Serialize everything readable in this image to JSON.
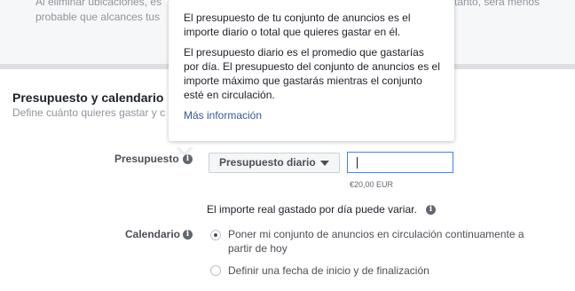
{
  "background_text": {
    "line1_left": "Al eliminar ubicaciones, es",
    "line1_right": "tanto, será menos",
    "line2": "probable que alcances tus"
  },
  "section": {
    "title": "Presupuesto y calendario",
    "subtitle": "Define cuánto quieres gastar y c"
  },
  "budget": {
    "label": "Presupuesto",
    "dropdown_value": "Presupuesto diario",
    "input_value": "",
    "hint": "€20,00 EUR",
    "note": "El importe real gastado por día puede variar."
  },
  "schedule": {
    "label": "Calendario",
    "options": [
      {
        "label": "Poner mi conjunto de anuncios en circulación continuamente a partir de hoy",
        "selected": true
      },
      {
        "label": "Definir una fecha de inicio y de finalización",
        "selected": false
      }
    ]
  },
  "tooltip": {
    "paragraph1": "El presupuesto de tu conjunto de anuncios es el importe diario o total que quieres gastar en él.",
    "paragraph2": "El presupuesto diario es el promedio que gastarías por día. El presupuesto del conjunto de anuncios es el importe máximo que gastarás mientras el conjunto esté en circulación.",
    "link": "Más información"
  },
  "icons": {
    "info": "info-icon",
    "caret": "caret-down-icon"
  },
  "colors": {
    "link": "#365899",
    "input_focus": "#4080ff"
  }
}
